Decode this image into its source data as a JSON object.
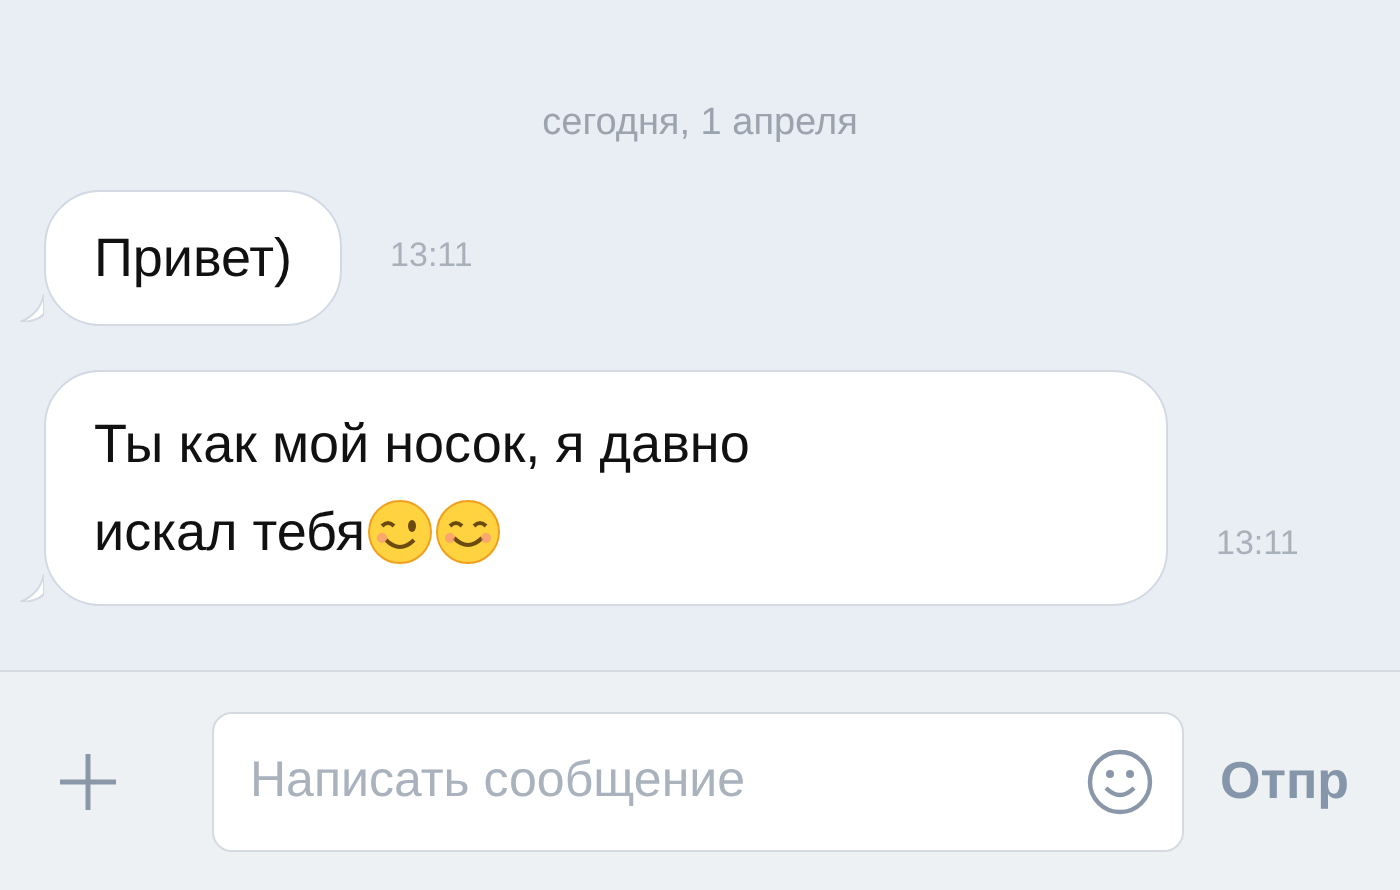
{
  "date_label": "сегодня, 1 апреля",
  "messages": [
    {
      "lines": [
        "Привет)"
      ],
      "time": "13:11"
    },
    {
      "lines": [
        "Ты как мой носок, я давно",
        "искал тебя"
      ],
      "time": "13:11",
      "emojis": [
        {
          "kind": "wink"
        },
        {
          "kind": "smile"
        }
      ]
    }
  ],
  "composer": {
    "placeholder": "Написать сообщение",
    "send_label": "Отпр"
  }
}
